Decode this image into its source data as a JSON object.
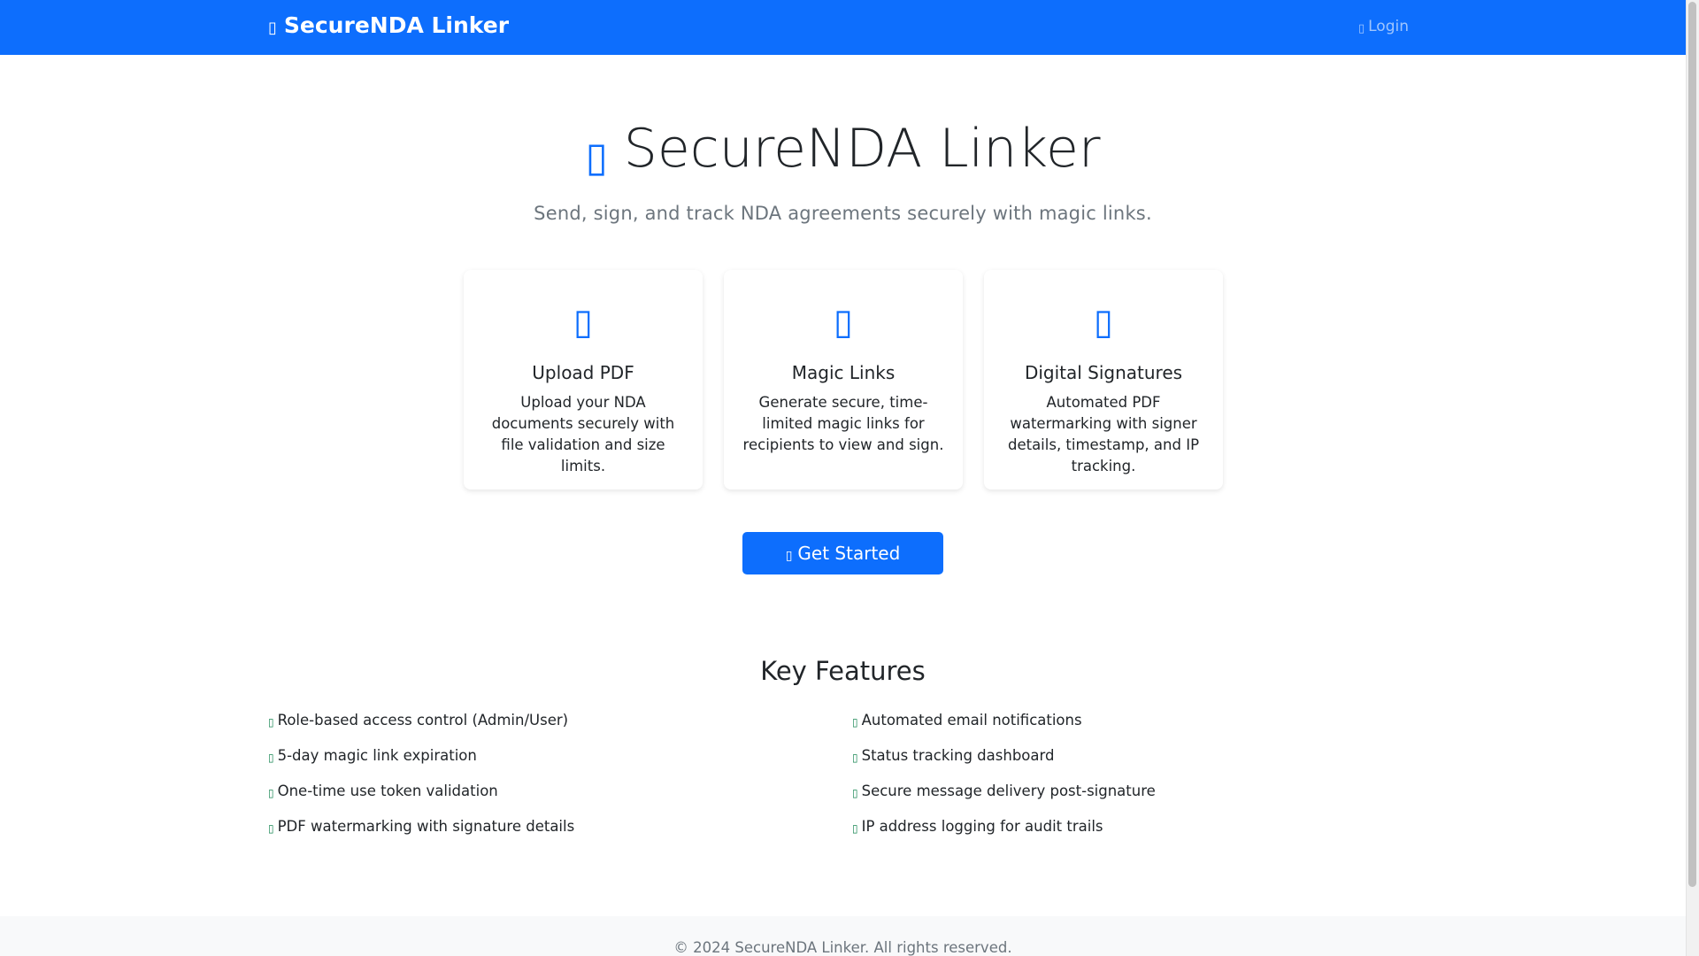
{
  "navbar": {
    "brand_icon": "shield-icon",
    "brand": "SecureNDA Linker",
    "login_icon": "sign-in-icon",
    "login": "Login"
  },
  "hero": {
    "icon": "shield-icon",
    "title": "SecureNDA Linker",
    "subtitle": "Send, sign, and track NDA agreements securely with magic links."
  },
  "cards": [
    {
      "icon": "upload-icon",
      "title": "Upload PDF",
      "text": "Upload your NDA documents securely with file validation and size limits."
    },
    {
      "icon": "link-icon",
      "title": "Magic Links",
      "text": "Generate secure, time-limited magic links for recipients to view and sign."
    },
    {
      "icon": "signature-icon",
      "title": "Digital Signatures",
      "text": "Automated PDF watermarking with signer details, timestamp, and IP tracking."
    }
  ],
  "cta": {
    "icon": "rocket-icon",
    "label": "Get Started"
  },
  "features": {
    "title": "Key Features",
    "items": [
      "Role-based access control (Admin/User)",
      "Automated email notifications",
      "5-day magic link expiration",
      "Status tracking dashboard",
      "One-time use token validation",
      "Secure message delivery post-signature",
      "PDF watermarking with signature details",
      "IP address logging for audit trails"
    ]
  },
  "footer": {
    "text": "© 2024 SecureNDA Linker. All rights reserved."
  },
  "colors": {
    "primary": "#0d6efd",
    "success": "#198754",
    "muted": "#6c757d"
  }
}
